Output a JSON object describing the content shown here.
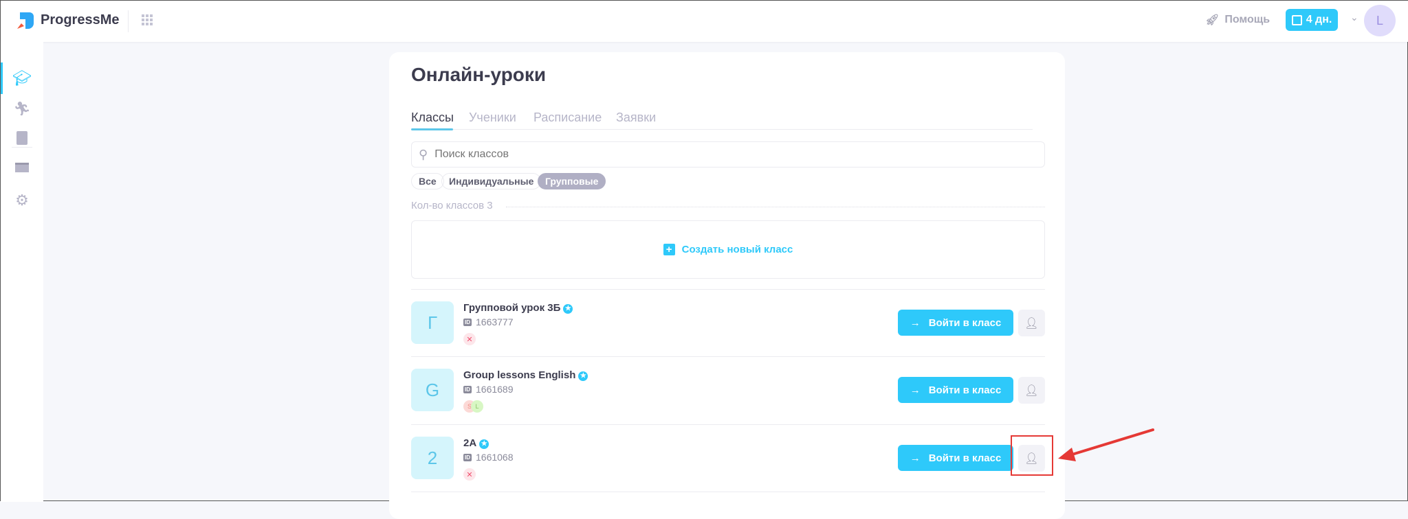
{
  "header": {
    "logo_text": "ProgressMe",
    "help_label": "Помощь",
    "days_badge": "4 дн.",
    "user_initial": "L"
  },
  "sidebar": {
    "items": [
      "courses-icon",
      "run-icon",
      "book-icon",
      "card-icon",
      "gear-icon"
    ]
  },
  "page": {
    "title": "Онлайн-уроки",
    "tabs": [
      {
        "label": "Классы",
        "active": true
      },
      {
        "label": "Ученики"
      },
      {
        "label": "Расписание"
      },
      {
        "label": "Заявки"
      }
    ],
    "search_placeholder": "Поиск классов",
    "filters": [
      {
        "label": "Все"
      },
      {
        "label": "Индивидуальные"
      },
      {
        "label": "Групповые",
        "active": true
      }
    ],
    "count_label": "Кол-во классов 3",
    "create_label": "Создать новый класс",
    "enter_label": "Войти в класс",
    "classes": [
      {
        "initial": "Г",
        "name": "Групповой урок 3Б",
        "id": "1663777",
        "members": "none"
      },
      {
        "initial": "G",
        "name": "Group lessons English",
        "id": "1661689",
        "members": [
          "S",
          "L"
        ]
      },
      {
        "initial": "2",
        "name": "2А",
        "id": "1661068",
        "members": "none"
      }
    ]
  },
  "colors": {
    "accent": "#2ec9fa",
    "annotation": "#e53935"
  }
}
